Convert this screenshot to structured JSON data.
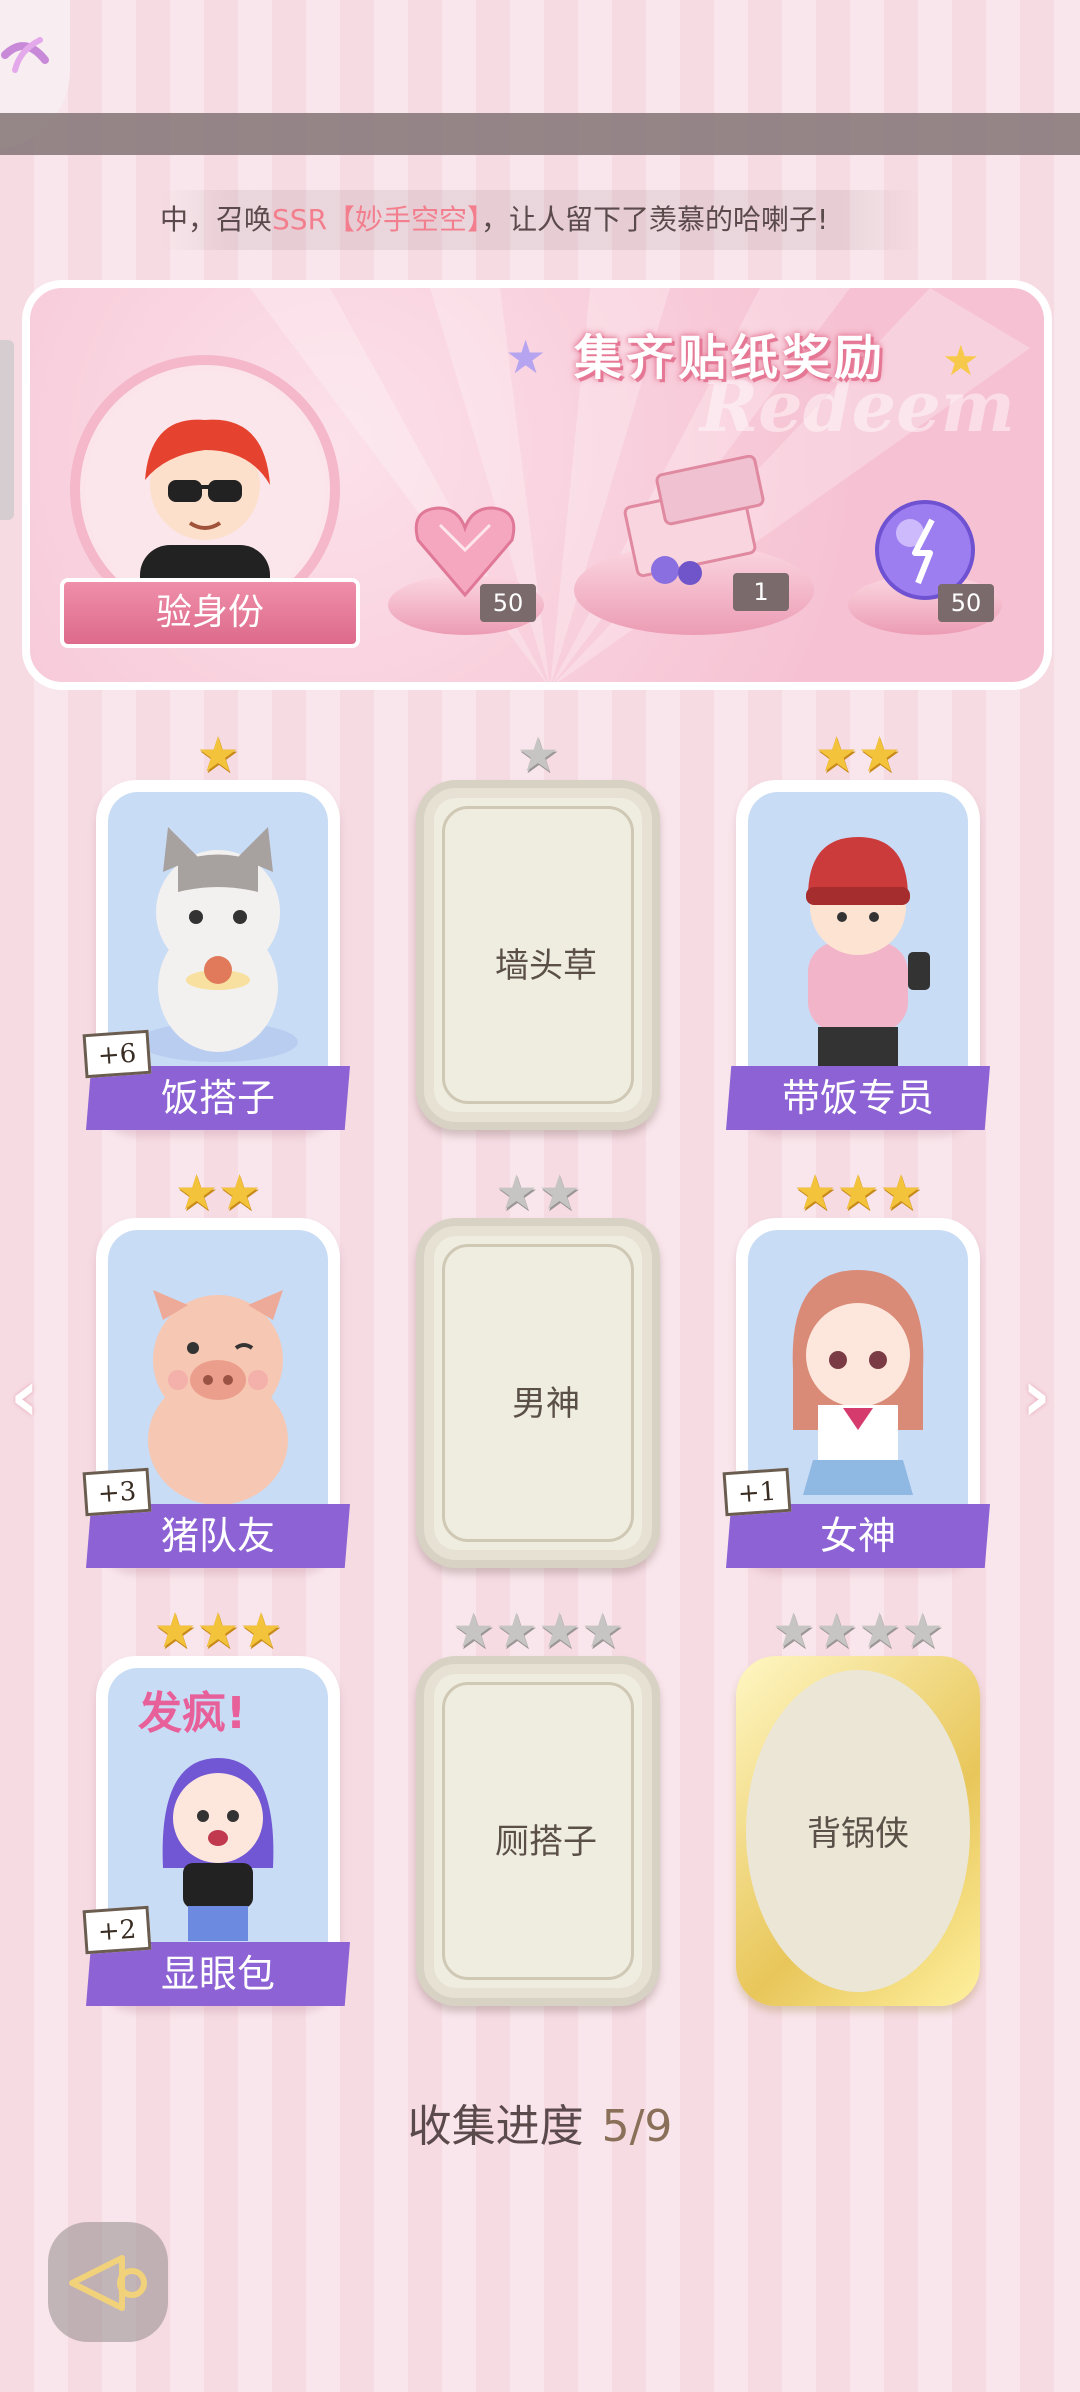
{
  "ticker": {
    "prefix": "中，召唤",
    "highlight": "SSR【妙手空空】",
    "suffix": "，让人留下了羡慕的哈喇子!"
  },
  "reward_banner": {
    "title": "集齐贴纸奖励",
    "watermark": "Redeem",
    "identity_button": "验身份",
    "rewards": [
      {
        "icon": "pink-heart-gem-icon",
        "qty": "50"
      },
      {
        "icon": "gift-box-icon",
        "qty": "1"
      },
      {
        "icon": "purple-orb-icon",
        "qty": "50"
      }
    ]
  },
  "cards": [
    {
      "name": "饭搭子",
      "stars": 1,
      "state": "collected",
      "plus": "+6",
      "art": "cat-icon"
    },
    {
      "name": "墙头草",
      "stars": 1,
      "state": "locked"
    },
    {
      "name": "带饭专员",
      "stars": 2,
      "state": "collected",
      "plus": "",
      "art": "girl-phone-icon"
    },
    {
      "name": "猪队友",
      "stars": 2,
      "state": "collected",
      "plus": "+3",
      "art": "pig-icon"
    },
    {
      "name": "男神",
      "stars": 2,
      "state": "locked"
    },
    {
      "name": "女神",
      "stars": 3,
      "state": "collected",
      "plus": "+1",
      "art": "girl-sailor-icon"
    },
    {
      "name": "显眼包",
      "stars": 3,
      "state": "collected",
      "plus": "+2",
      "art": "girl-crazy-icon"
    },
    {
      "name": "厕搭子",
      "stars": 4,
      "state": "locked"
    },
    {
      "name": "背锅侠",
      "stars": 4,
      "state": "gold-locked"
    }
  ],
  "progress": {
    "label": "收集进度",
    "value": "5/9"
  },
  "icons": {
    "left_arrow": "chevron-left-icon",
    "right_arrow": "chevron-right-icon",
    "back": "back-icon"
  },
  "colors": {
    "label_purple": "#8d62d5",
    "highlight_pink": "#f37f8e",
    "star_gold": "#f3c33c",
    "star_grey": "#c7c4c4"
  }
}
